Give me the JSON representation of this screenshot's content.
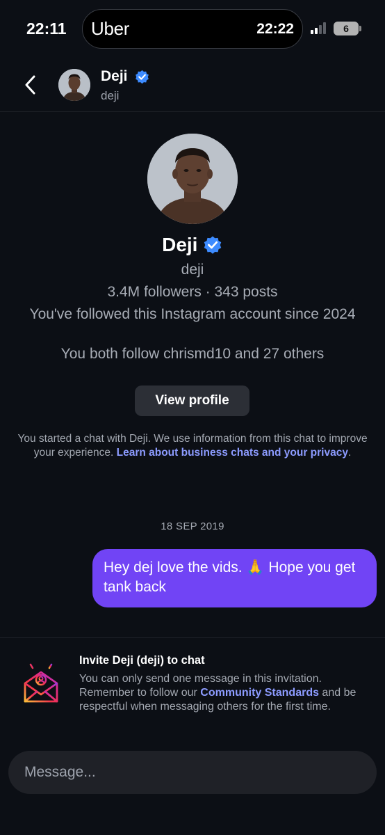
{
  "status_bar": {
    "time": "22:11",
    "live_activity_app": "Uber",
    "live_activity_time": "22:22",
    "battery_level": "6",
    "signal_icon": "cellular-signal-icon",
    "battery_icon": "battery-icon"
  },
  "header": {
    "name": "Deji",
    "username": "deji",
    "verified_icon": "verified-badge-icon",
    "back_icon": "chevron-left-icon"
  },
  "profile": {
    "name": "Deji",
    "username": "deji",
    "stats": "3.4M followers · 343 posts",
    "followed_since": "You've followed this Instagram account since 2024",
    "mutual": "You both follow chrismd10 and 27 others",
    "view_profile_label": "View profile"
  },
  "notice": {
    "text": "You started a chat with Deji. We use information from this chat to improve your experience. ",
    "link": "Learn about business chats and your privacy",
    "suffix": "."
  },
  "conversation": {
    "date": "18 SEP 2019",
    "messages": [
      {
        "text": "Hey dej love the vids. 🙏 Hope you get tank back",
        "from": "me"
      }
    ]
  },
  "invite": {
    "title": "Invite Deji (deji) to chat",
    "text": "You can only send one message in this invitation. Remember to follow our ",
    "link": "Community Standards",
    "text_after": " and be respectful when messaging others for the first time.",
    "icon": "invite-envelope-icon"
  },
  "composer": {
    "placeholder": "Message..."
  },
  "colors": {
    "background": "#0c0f15",
    "bubble": "#7144f5",
    "link": "#8c9bff",
    "verified": "#3d8bff"
  }
}
